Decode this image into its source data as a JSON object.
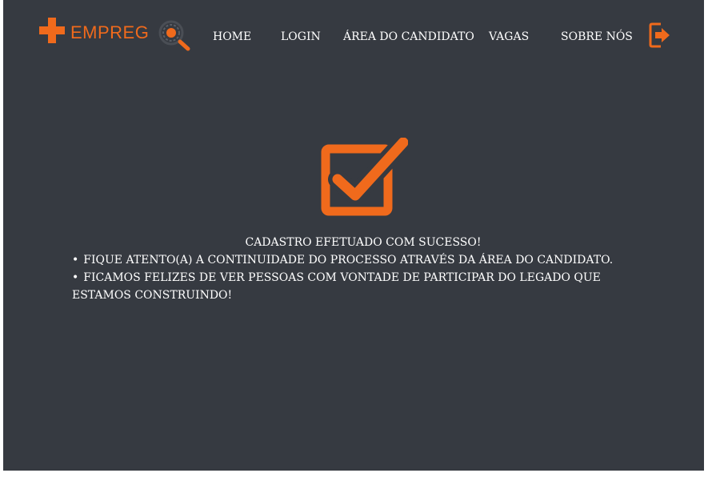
{
  "brand": {
    "name": "EMPREG",
    "accent": "#f06a1c",
    "logo_icons": [
      "plus-icon",
      "magnifier-icon"
    ]
  },
  "nav": {
    "home": "HOME",
    "login": "LOGIN",
    "area": "ÁREA DO CANDIDATO",
    "vagas": "VAGAS",
    "sobre": "SOBRE NÓS",
    "logout_icon": "logout-icon"
  },
  "message": {
    "title": "CADASTRO EFETUADO COM SUCESSO!",
    "bullet_symbol": "•",
    "items": [
      "FIQUE ATENTO(A) A CONTINUIDADE DO PROCESSO ATRAVÉS DA ÁREA DO CANDIDATO.",
      "FICAMOS FELIZES DE VER PESSOAS COM VONTADE DE PARTICIPAR DO LEGADO QUE ESTAMOS CONSTRUINDO!"
    ],
    "icon": "checkbox-checked-icon"
  },
  "colors": {
    "background": "#363a41",
    "text": "#ffffff",
    "accent": "#f06a1c"
  }
}
